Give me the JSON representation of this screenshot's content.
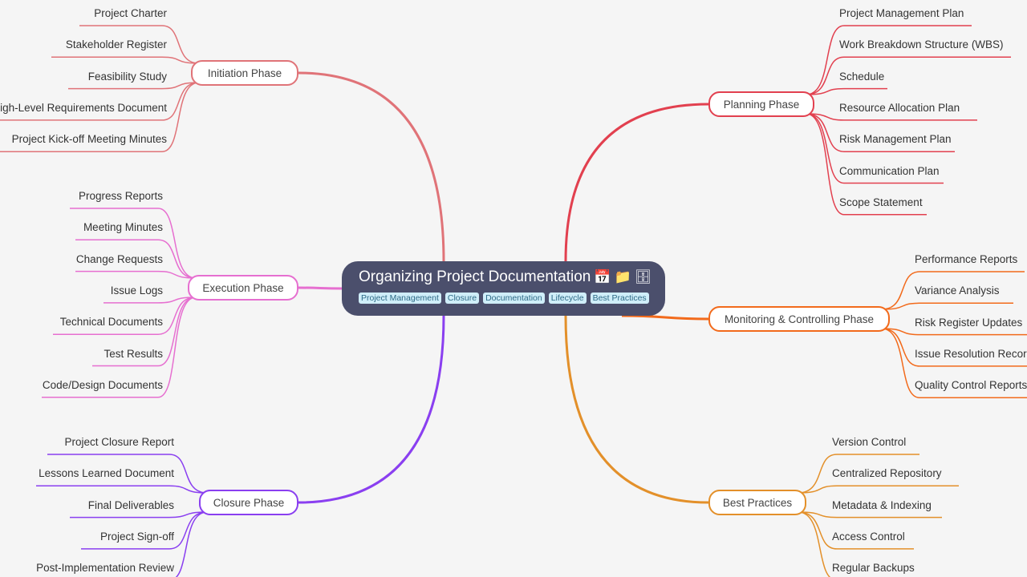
{
  "root": {
    "title": "Organizing Project Documentation",
    "icons": [
      "calendar-icon",
      "folder-icon",
      "file-cabinet-icon"
    ],
    "tags": [
      "Project Management",
      "Closure",
      "Documentation",
      "Lifecycle",
      "Best Practices"
    ]
  },
  "branches": [
    {
      "id": "initiation",
      "label": "Initiation Phase",
      "color": "#e07378",
      "side": "left",
      "children": [
        "Project Charter",
        "Stakeholder Register",
        "Feasibility Study",
        "High-Level Requirements Document",
        "Project Kick-off Meeting Minutes"
      ]
    },
    {
      "id": "execution",
      "label": "Execution Phase",
      "color": "#e66fd0",
      "side": "left",
      "children": [
        "Progress Reports",
        "Meeting Minutes",
        "Change Requests",
        "Issue Logs",
        "Technical Documents",
        "Test Results",
        "Code/Design Documents"
      ]
    },
    {
      "id": "closure",
      "label": "Closure Phase",
      "color": "#8a3ff0",
      "side": "left",
      "children": [
        "Project Closure Report",
        "Lessons Learned Document",
        "Final Deliverables",
        "Project Sign-off",
        "Post-Implementation Review"
      ]
    },
    {
      "id": "planning",
      "label": "Planning Phase",
      "color": "#e2404f",
      "side": "right",
      "children": [
        "Project Management Plan",
        "Work Breakdown Structure (WBS)",
        "Schedule",
        "Resource Allocation Plan",
        "Risk Management Plan",
        "Communication Plan",
        "Scope Statement"
      ]
    },
    {
      "id": "monitoring",
      "label": "Monitoring & Controlling Phase",
      "color": "#f26a1b",
      "side": "right",
      "children": [
        "Performance Reports",
        "Variance Analysis",
        "Risk Register Updates",
        "Issue Resolution Records",
        "Quality Control Reports"
      ]
    },
    {
      "id": "best-practices",
      "label": "Best Practices",
      "color": "#e3902a",
      "side": "right",
      "children": [
        "Version Control",
        "Centralized Repository",
        "Metadata & Indexing",
        "Access Control",
        "Regular Backups"
      ]
    }
  ]
}
